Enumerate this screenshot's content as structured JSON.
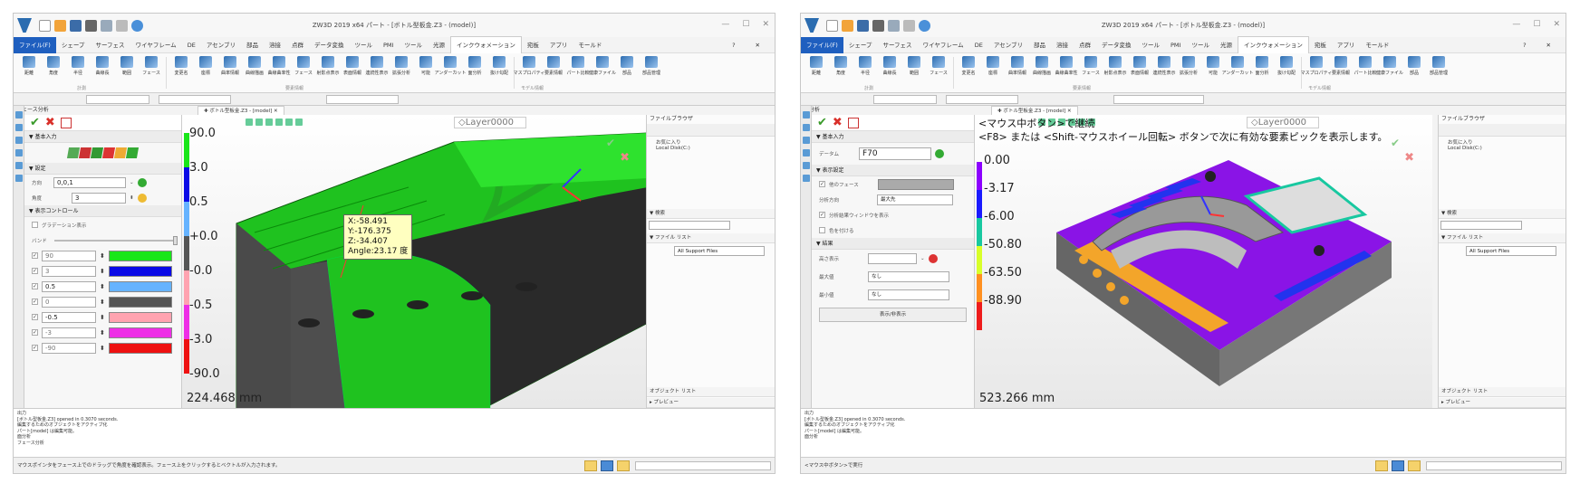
{
  "s1": {
    "app_title": "ZW3D 2019 x64   パート - [ボトル型板金.Z3 - (model)]",
    "menu": [
      "ファイル(F)",
      "シェープ",
      "サーフェス",
      "ワイヤフレーム",
      "DE",
      "アセンブリ",
      "部品",
      "溶接",
      "点群",
      "データ変換",
      "ツール",
      "PMI",
      "ツール",
      "光源",
      "インクウォメーション",
      "宛板",
      "アプリ",
      "モールド"
    ],
    "ribbon": [
      "距離",
      "角度",
      "半径",
      "曲線長",
      "範囲",
      "フェース",
      "変更名",
      "座標",
      "曲率情報",
      "曲線描画",
      "曲線曲率性",
      "フェース",
      "射影点表示",
      "表面情報",
      "連続性表示",
      "拡張分析",
      "可能",
      "アンダーカット",
      "面分析",
      "抜け勾配",
      "マスプロパティ",
      "要素情報",
      "パート比較",
      "健康ファイル",
      "部品",
      "部品管理"
    ],
    "ribbon_groups": [
      "計測",
      "要素情報",
      "モデル情報"
    ],
    "panel_title": "フェース分析",
    "doc_tab": "ボトル型板金.Z3 - [model]",
    "sections": {
      "basic": "基本入力",
      "settings": "設定",
      "display": "表示コントロール"
    },
    "direction_label": "方向",
    "direction_value": "0,0,1",
    "angle_label": "角度",
    "angle_value": "3",
    "gradation_label": "グラデーション表示",
    "band_label": "バンド",
    "bands": [
      {
        "value": "90",
        "color": "#19e619"
      },
      {
        "value": "3",
        "color": "#0a0ae6"
      },
      {
        "value": "0.5",
        "color": "#66b3ff"
      },
      {
        "value": "0",
        "color": "#555555"
      },
      {
        "value": "-0.5",
        "color": "#ffa3b0"
      },
      {
        "value": "-3",
        "color": "#ee2ee6"
      },
      {
        "value": "-90",
        "color": "#ee1111"
      }
    ],
    "legend": [
      "90.0",
      "3.0",
      "0.5",
      "+0.0",
      "-0.0",
      "-0.5",
      "-3.0",
      "-90.0"
    ],
    "layer": "Layer0000",
    "popup": [
      "X:-58.491",
      "Y:-176.375",
      "Z:-34.407",
      "Angle:23.17 度"
    ],
    "distance": "224.468 mm",
    "right_panel": {
      "title": "ファイルブラウザ",
      "items": [
        "お気に入り",
        "Local Disk(C:)"
      ],
      "search": "検索",
      "file_list": "ファイル リスト",
      "filter": "All Support Files",
      "object_list": "オブジェクト リスト",
      "preview": "プレビュー"
    },
    "output_title": "出力",
    "output": [
      "[ボトル型板金.Z3] opened in 0.3070 seconds.",
      "編集するためのオブジェクトをアクティブ化",
      "パート[model] は編集可能。",
      "面分析",
      "フェース分析"
    ],
    "status": "マウスポインタをフェース上でのドラッグで角度を確認表示。フェース上をクリックするとベクトルが入力されます。"
  },
  "s2": {
    "app_title": "ZW3D 2019 x64   パート - [ボトル型板金.Z3 - (model)]",
    "menu": [
      "ファイル(F)",
      "シェープ",
      "サーフェス",
      "ワイヤフレーム",
      "DE",
      "アセンブリ",
      "部品",
      "溶接",
      "点群",
      "データ変換",
      "ツール",
      "PMI",
      "ツール",
      "光源",
      "インクウォメーション",
      "宛板",
      "アプリ",
      "モールド"
    ],
    "ribbon": [
      "距離",
      "角度",
      "半径",
      "曲線長",
      "範囲",
      "フェース",
      "変更名",
      "座標",
      "曲率情報",
      "曲線描画",
      "曲線曲率性",
      "フェース",
      "射影点表示",
      "表面情報",
      "連続性表示",
      "拡張分析",
      "可能",
      "アンダーカット",
      "面分析",
      "抜け勾配",
      "マスプロパティ",
      "要素情報",
      "パート比較",
      "健康ファイル",
      "部品",
      "部品管理"
    ],
    "ribbon_groups": [
      "計測",
      "要素情報",
      "モデル情報"
    ],
    "panel_title": "面分析",
    "doc_tab": "ボトル型板金.Z3 - [model]",
    "sections": {
      "basic": "基本入力",
      "display": "表示設定",
      "result": "結果"
    },
    "datum_label": "データム",
    "datum_value": "F70",
    "other_face_label": "他のフェース",
    "direction_label": "分析方向",
    "direction_value": "最大先",
    "opt1": "分析結果ウィンドウを表示",
    "opt2": "色を付ける",
    "height_label": "高さ表示",
    "max_label": "最大値",
    "max_value": "なし",
    "min_label": "最小値",
    "min_value": "なし",
    "toggle_btn": "表示/非表示",
    "hint1": "<マウス中ボタン>で継続",
    "hint2": "<F8> または <Shift-マウスホイール回転> ボタンで次に有効な要素ピックを表示します。",
    "legend": [
      "0.00",
      "-3.17",
      "-6.00",
      "-50.80",
      "-63.50",
      "-88.90"
    ],
    "legend_colors": [
      "#8c00ff",
      "#1a1aff",
      "#18c8a0",
      "#d8ff2a",
      "#ff9020",
      "#ee1c1c"
    ],
    "layer": "Layer0000",
    "distance": "523.266 mm",
    "right_panel": {
      "title": "ファイルブラウザ",
      "items": [
        "お気に入り",
        "Local Disk(C:)"
      ],
      "search": "検索",
      "file_list": "ファイル リスト",
      "filter": "All Support Files",
      "object_list": "オブジェクト リスト",
      "preview": "プレビュー"
    },
    "output_title": "出力",
    "output": [
      "[ボトル型板金.Z3] opened in 0.3070 seconds.",
      "編集するためのオブジェクトをアクティブ化",
      "パート[model] は編集可能。",
      "面分析"
    ],
    "status": "<マウス中ボタン>で実行"
  }
}
